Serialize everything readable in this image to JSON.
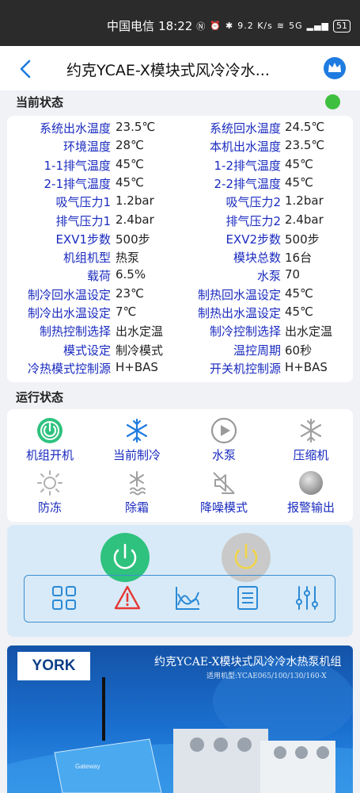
{
  "status_bar": {
    "carrier": "中国电信",
    "time": "18:22",
    "network_speed": "9.2 K/s",
    "signal_label": "5G",
    "battery": "51"
  },
  "app_bar": {
    "title": "约克YCAE-X模块式风冷冷水..."
  },
  "sections": {
    "current_status": "当前状态",
    "run_status": "运行状态"
  },
  "params": [
    {
      "l1": "系统出水温度",
      "v1": "23.5℃",
      "l2": "系统回水温度",
      "v2": "24.5℃"
    },
    {
      "l1": "环境温度",
      "v1": "28℃",
      "l2": "本机出水温度",
      "v2": "23.5℃"
    },
    {
      "l1": "1-1排气温度",
      "v1": "45℃",
      "l2": "1-2排气温度",
      "v2": "45℃"
    },
    {
      "l1": "2-1排气温度",
      "v1": "45℃",
      "l2": "2-2排气温度",
      "v2": "45℃"
    },
    {
      "l1": "吸气压力1",
      "v1": "1.2bar",
      "l2": "吸气压力2",
      "v2": "1.2bar"
    },
    {
      "l1": "排气压力1",
      "v1": "2.4bar",
      "l2": "排气压力2",
      "v2": "2.4bar"
    },
    {
      "l1": "EXV1步数",
      "v1": "500步",
      "l2": "EXV2步数",
      "v2": "500步"
    },
    {
      "l1": "机组机型",
      "v1": "热泵",
      "l2": "模块总数",
      "v2": "16台"
    },
    {
      "l1": "载荷",
      "v1": "6.5%",
      "l2": "水泵",
      "v2": "70"
    },
    {
      "l1": "制冷回水温设定",
      "v1": "23℃",
      "l2": "制热回水温设定",
      "v2": "45℃"
    },
    {
      "l1": "制冷出水温设定",
      "v1": "7℃",
      "l2": "制热出水温设定",
      "v2": "45℃"
    },
    {
      "l1": "制热控制选择",
      "v1": "出水定温",
      "l2": "制冷控制选择",
      "v2": "出水定温"
    },
    {
      "l1": "模式设定",
      "v1": "制冷模式",
      "l2": "温控周期",
      "v2": "60秒"
    },
    {
      "l1": "冷热模式控制源",
      "v1": "H+BAS",
      "l2": "开关机控制源",
      "v2": "H+BAS"
    }
  ],
  "run_items": [
    {
      "label": "机组开机",
      "icon": "power-on-icon"
    },
    {
      "label": "当前制冷",
      "icon": "snowflake-icon"
    },
    {
      "label": "水泵",
      "icon": "pump-play-icon"
    },
    {
      "label": "压缩机",
      "icon": "compressor-snowflake-icon"
    },
    {
      "label": "防冻",
      "icon": "sun-icon"
    },
    {
      "label": "除霜",
      "icon": "defrost-icon"
    },
    {
      "label": "降噪模式",
      "icon": "mute-icon"
    },
    {
      "label": "报警输出",
      "icon": "alarm-dot-icon"
    }
  ],
  "colors": {
    "label_blue": "#1a2bbf",
    "status_ok": "#3fbf3f",
    "power_on": "#2ec27e",
    "power_off": "#c9c9c9",
    "warning_red": "#e53935",
    "panel_bg": "#d8eaf7"
  },
  "banner": {
    "brand": "YORK",
    "title": "约克YCAE-X模块式风冷冷水热泵机组",
    "subtitle": "适用机型:YCAE065/100/130/160-X",
    "device_label": "Gateway"
  }
}
